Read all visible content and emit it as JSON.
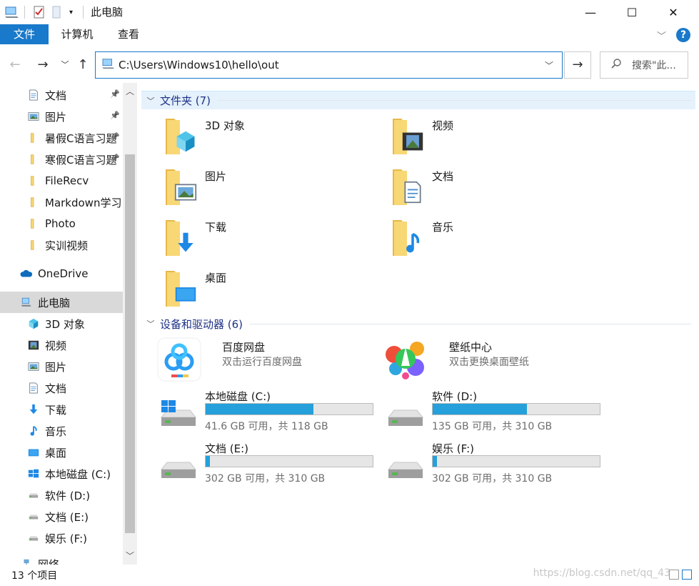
{
  "window": {
    "title": "此电脑",
    "minimize_icon": "minimize-icon",
    "maximize_icon": "maximize-icon",
    "close_icon": "close-icon"
  },
  "ribbon": {
    "tabs": [
      "文件",
      "计算机",
      "查看"
    ],
    "help_label": "?"
  },
  "nav": {
    "address": "C:\\Users\\Windows10\\hello\\out",
    "search_placeholder": "搜索\"此..."
  },
  "sidebar": {
    "items": [
      {
        "label": "文档",
        "icon": "document-icon",
        "pinned": true
      },
      {
        "label": "图片",
        "icon": "picture-icon",
        "pinned": true
      },
      {
        "label": "暑假C语言习题",
        "icon": "folder-icon",
        "pinned": true
      },
      {
        "label": "寒假C语言习题",
        "icon": "folder-icon",
        "pinned": true
      },
      {
        "label": "FileRecv",
        "icon": "folder-icon",
        "pinned": false
      },
      {
        "label": "Markdown学习",
        "icon": "folder-icon",
        "pinned": false
      },
      {
        "label": "Photo",
        "icon": "folder-icon",
        "pinned": false
      },
      {
        "label": "实训视频",
        "icon": "folder-icon",
        "pinned": false
      },
      {
        "label": "OneDrive",
        "icon": "onedrive-icon",
        "pinned": false
      },
      {
        "label": "此电脑",
        "icon": "computer-icon",
        "pinned": false,
        "selected": true
      },
      {
        "label": "3D 对象",
        "icon": "3d-objects-icon",
        "pinned": false
      },
      {
        "label": "视频",
        "icon": "video-icon",
        "pinned": false
      },
      {
        "label": "图片",
        "icon": "picture-icon",
        "pinned": false
      },
      {
        "label": "文档",
        "icon": "document-icon",
        "pinned": false
      },
      {
        "label": "下载",
        "icon": "download-icon",
        "pinned": false
      },
      {
        "label": "音乐",
        "icon": "music-icon",
        "pinned": false
      },
      {
        "label": "桌面",
        "icon": "desktop-icon",
        "pinned": false
      },
      {
        "label": "本地磁盘 (C:)",
        "icon": "windows-drive-icon",
        "pinned": false
      },
      {
        "label": "软件 (D:)",
        "icon": "drive-icon",
        "pinned": false
      },
      {
        "label": "文档 (E:)",
        "icon": "drive-icon",
        "pinned": false
      },
      {
        "label": "娱乐 (F:)",
        "icon": "drive-icon",
        "pinned": false
      },
      {
        "label": "网络",
        "icon": "network-icon",
        "pinned": false
      }
    ]
  },
  "folders": {
    "header": "文件夹 (7)",
    "items": [
      {
        "label": "3D 对象",
        "overlay": "3d-objects-icon"
      },
      {
        "label": "视频",
        "overlay": "video-icon"
      },
      {
        "label": "图片",
        "overlay": "picture-icon"
      },
      {
        "label": "文档",
        "overlay": "document-icon"
      },
      {
        "label": "下载",
        "overlay": "download-icon"
      },
      {
        "label": "音乐",
        "overlay": "music-icon"
      },
      {
        "label": "桌面",
        "overlay": "desktop-icon"
      }
    ]
  },
  "devices": {
    "header": "设备和驱动器 (6)",
    "apps": [
      {
        "label": "百度网盘",
        "sub": "双击运行百度网盘",
        "icon": "baidu-netdisk-icon"
      },
      {
        "label": "壁纸中心",
        "sub": "双击更换桌面壁纸",
        "icon": "wallpaper-center-icon"
      }
    ],
    "drives": [
      {
        "label": "本地磁盘 (C:)",
        "sub": "41.6 GB 可用，共 118 GB",
        "used_fraction": 0.647,
        "icon": "windows-drive-icon"
      },
      {
        "label": "软件 (D:)",
        "sub": "135 GB 可用，共 310 GB",
        "used_fraction": 0.565,
        "icon": "drive-icon"
      },
      {
        "label": "文档 (E:)",
        "sub": "302 GB 可用，共 310 GB",
        "used_fraction": 0.026,
        "icon": "drive-icon"
      },
      {
        "label": "娱乐 (F:)",
        "sub": "302 GB 可用，共 310 GB",
        "used_fraction": 0.026,
        "icon": "drive-icon"
      }
    ]
  },
  "status": {
    "count": "13 个项目",
    "watermark": "https://blog.csdn.net/qq_43"
  },
  "colors": {
    "accent": "#1979ca",
    "drive_fill": "#26a0da",
    "folder": "#f8d775",
    "selected_bg": "#d9d9d9"
  }
}
